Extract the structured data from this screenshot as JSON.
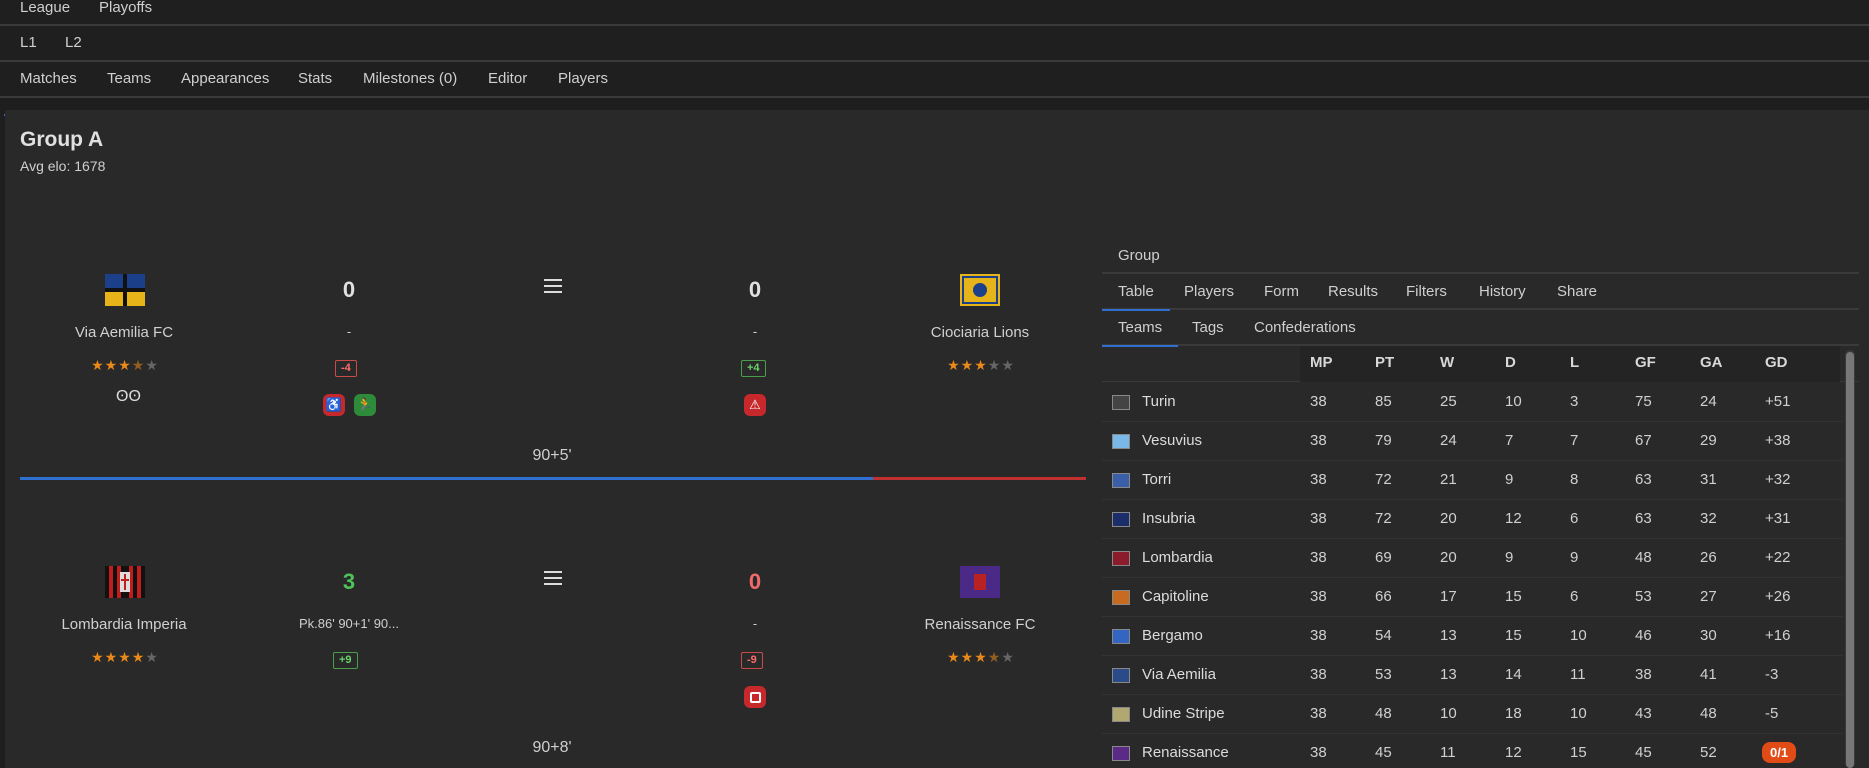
{
  "top_tabs": [
    "League",
    "Playoffs"
  ],
  "level_tabs": [
    "L1",
    "L2"
  ],
  "section_tabs": [
    "Matches",
    "Teams",
    "Appearances",
    "Stats",
    "Milestones (0)",
    "Editor",
    "Players"
  ],
  "group": {
    "title": "Group A",
    "avg_elo": "Avg elo: 1678"
  },
  "matches": [
    {
      "home": {
        "name": "Via Aemilia FC",
        "rating": 3.5,
        "score": "0",
        "scorers": "-",
        "elo": "-4",
        "extra_icon": "link-rings-icon"
      },
      "away": {
        "name": "Ciociaria Lions",
        "rating": 3,
        "score": "0",
        "scorers": "-",
        "elo": "+4"
      },
      "minute": "90+5'",
      "home_events": [
        "wheelchair-icon",
        "substitution-runner-icon"
      ],
      "away_events": [
        "warning-triangle-icon"
      ],
      "progress_home_fraction": 0.805
    },
    {
      "home": {
        "name": "Lombardia Imperia",
        "rating": 4,
        "score": "3",
        "scorers": "Pk.86' 90+1' 90...",
        "elo": "+9"
      },
      "away": {
        "name": "Renaissance FC",
        "rating": 3.5,
        "score": "0",
        "scorers": "-",
        "elo": "-9"
      },
      "minute": "90+8'",
      "home_events": [],
      "away_events": [
        "red-card-icon"
      ]
    }
  ],
  "colors": {
    "accent": "#2f6fd0",
    "win": "#4fc25a",
    "loss": "#f06b6b",
    "star": "#e8891a",
    "progress_home": "#2f6fd0",
    "progress_away": "#c0302e",
    "pill": "#e14b16"
  },
  "right": {
    "header_tab": "Group",
    "main_tabs": [
      "Table",
      "Players",
      "Form",
      "Results",
      "Filters",
      "History",
      "Share"
    ],
    "sub_tabs": [
      "Teams",
      "Tags",
      "Confederations"
    ],
    "columns": [
      "MP",
      "PT",
      "W",
      "D",
      "L",
      "GF",
      "GA",
      "GD"
    ],
    "rows": [
      {
        "name": "Turin",
        "mp": "38",
        "pt": "85",
        "w": "25",
        "d": "10",
        "l": "3",
        "gf": "75",
        "ga": "24",
        "gd": "+51"
      },
      {
        "name": "Vesuvius",
        "mp": "38",
        "pt": "79",
        "w": "24",
        "d": "7",
        "l": "7",
        "gf": "67",
        "ga": "29",
        "gd": "+38"
      },
      {
        "name": "Torri",
        "mp": "38",
        "pt": "72",
        "w": "21",
        "d": "9",
        "l": "8",
        "gf": "63",
        "ga": "31",
        "gd": "+32"
      },
      {
        "name": "Insubria",
        "mp": "38",
        "pt": "72",
        "w": "20",
        "d": "12",
        "l": "6",
        "gf": "63",
        "ga": "32",
        "gd": "+31"
      },
      {
        "name": "Lombardia",
        "mp": "38",
        "pt": "69",
        "w": "20",
        "d": "9",
        "l": "9",
        "gf": "48",
        "ga": "26",
        "gd": "+22"
      },
      {
        "name": "Capitoline",
        "mp": "38",
        "pt": "66",
        "w": "17",
        "d": "15",
        "l": "6",
        "gf": "53",
        "ga": "27",
        "gd": "+26"
      },
      {
        "name": "Bergamo",
        "mp": "38",
        "pt": "54",
        "w": "13",
        "d": "15",
        "l": "10",
        "gf": "46",
        "ga": "30",
        "gd": "+16"
      },
      {
        "name": "Via Aemilia",
        "mp": "38",
        "pt": "53",
        "w": "13",
        "d": "14",
        "l": "11",
        "gf": "38",
        "ga": "41",
        "gd": "-3"
      },
      {
        "name": "Udine Stripe",
        "mp": "38",
        "pt": "48",
        "w": "10",
        "d": "18",
        "l": "10",
        "gf": "43",
        "ga": "48",
        "gd": "-5"
      },
      {
        "name": "Renaissance",
        "mp": "38",
        "pt": "45",
        "w": "11",
        "d": "12",
        "l": "15",
        "gf": "45",
        "ga": "52",
        "gd": "0/1"
      }
    ]
  }
}
